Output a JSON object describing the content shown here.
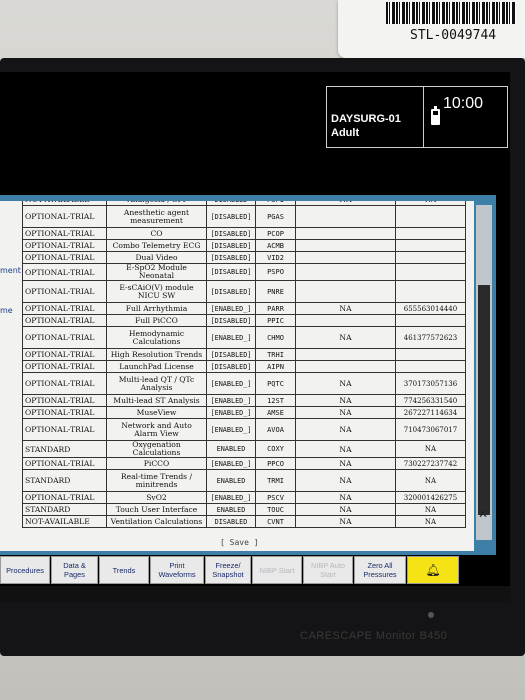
{
  "asset_label": "STL-0049744",
  "header": {
    "bed_name": "DAYSURG-01",
    "patient_category": "Adult",
    "clock": "10:00"
  },
  "side_fragments": [
    "ment",
    "me"
  ],
  "options_table": {
    "rows": [
      {
        "status": "NOT-AVAILABLE",
        "function": "Analgesia / SPI",
        "state": "DISABLED",
        "code": "PSPI",
        "col1": "NA",
        "col2": "NA"
      },
      {
        "status": "OPTIONAL-TRIAL",
        "function": "Anesthetic agent measurement",
        "state": "[DISABLED]",
        "code": "PGAS",
        "col1": "",
        "col2": ""
      },
      {
        "status": "OPTIONAL-TRIAL",
        "function": "CO",
        "state": "[DISABLED]",
        "code": "PCOP",
        "col1": "",
        "col2": ""
      },
      {
        "status": "OPTIONAL-TRIAL",
        "function": "Combo Telemetry ECG",
        "state": "[DISABLED]",
        "code": "ACMB",
        "col1": "",
        "col2": ""
      },
      {
        "status": "OPTIONAL-TRIAL",
        "function": "Dual Video",
        "state": "[DISABLED]",
        "code": "VID2",
        "col1": "",
        "col2": ""
      },
      {
        "status": "OPTIONAL-TRIAL",
        "function": "E-SpO2 Module Neonatal",
        "state": "[DISABLED]",
        "code": "PSPO",
        "col1": "",
        "col2": ""
      },
      {
        "status": "OPTIONAL-TRIAL",
        "function": "E-sCAiO(V) module NICU SW",
        "state": "[DISABLED]",
        "code": "PNRE",
        "col1": "",
        "col2": ""
      },
      {
        "status": "OPTIONAL-TRIAL",
        "function": "Full Arrhythmia",
        "state": "[ENABLED_]",
        "code": "PARR",
        "col1": "NA",
        "col2": "655563014440"
      },
      {
        "status": "OPTIONAL-TRIAL",
        "function": "Full PiCCO",
        "state": "[DISABLED]",
        "code": "PPIC",
        "col1": "",
        "col2": ""
      },
      {
        "status": "OPTIONAL-TRIAL",
        "function": "Hemodynamic Calculations",
        "state": "[ENABLED_]",
        "code": "CHMO",
        "col1": "NA",
        "col2": "461377572623"
      },
      {
        "status": "OPTIONAL-TRIAL",
        "function": "High Resolution Trends",
        "state": "[DISABLED]",
        "code": "TRHI",
        "col1": "",
        "col2": ""
      },
      {
        "status": "OPTIONAL-TRIAL",
        "function": "LaunchPad License",
        "state": "[DISABLED]",
        "code": "AIPN",
        "col1": "",
        "col2": ""
      },
      {
        "status": "OPTIONAL-TRIAL",
        "function": "Multi-lead QT / QTc Analysis",
        "state": "[ENABLED_]",
        "code": "PQTC",
        "col1": "NA",
        "col2": "370173057136"
      },
      {
        "status": "OPTIONAL-TRIAL",
        "function": "Multi-lead ST Analysis",
        "state": "[ENABLED_]",
        "code": "12ST",
        "col1": "NA",
        "col2": "774256331540"
      },
      {
        "status": "OPTIONAL-TRIAL",
        "function": "MuseView",
        "state": "[ENABLED_]",
        "code": "AMSE",
        "col1": "NA",
        "col2": "267227114634"
      },
      {
        "status": "OPTIONAL-TRIAL",
        "function": "Network and Auto Alarm View",
        "state": "[ENABLED_]",
        "code": "AVOA",
        "col1": "NA",
        "col2": "710473067017"
      },
      {
        "status": "STANDARD",
        "function": "Oxygenation Calculations",
        "state": "ENABLED",
        "code": "COXY",
        "col1": "NA",
        "col2": "NA"
      },
      {
        "status": "OPTIONAL-TRIAL",
        "function": "PiCCO",
        "state": "[ENABLED_]",
        "code": "PPCO",
        "col1": "NA",
        "col2": "730227237742"
      },
      {
        "status": "STANDARD",
        "function": "Real-time Trends / minitrends",
        "state": "ENABLED",
        "code": "TRMI",
        "col1": "NA",
        "col2": "NA"
      },
      {
        "status": "OPTIONAL-TRIAL",
        "function": "SvO2",
        "state": "[ENABLED_]",
        "code": "PSCV",
        "col1": "NA",
        "col2": "320001426275"
      },
      {
        "status": "STANDARD",
        "function": "Touch User Interface",
        "state": "ENABLED",
        "code": "TOUC",
        "col1": "NA",
        "col2": "NA"
      },
      {
        "status": "NOT-AVAILABLE",
        "function": "Ventilation Calculations",
        "state": "DISABLED",
        "code": "CVNT",
        "col1": "NA",
        "col2": "NA"
      }
    ]
  },
  "save_label": "[ Save ]",
  "menu": {
    "procedures": "Procedures",
    "data_pages": "Data & Pages",
    "trends": "Trends",
    "print_waveforms": "Print Waveforms",
    "freeze_snapshot": "Freeze/ Snapshot",
    "nibp_start": "NIBP Start",
    "nibp_auto": "NIBP Auto Start",
    "zero_all": "Zero All Pressures"
  },
  "colors": {
    "dialog_frame": "#3e7fa8",
    "alarm_button": "#f5e316",
    "menu_text": "#1a2a6a"
  },
  "alarm_icon": "bell-icon",
  "brand": "CARESCAPE Monitor B450"
}
